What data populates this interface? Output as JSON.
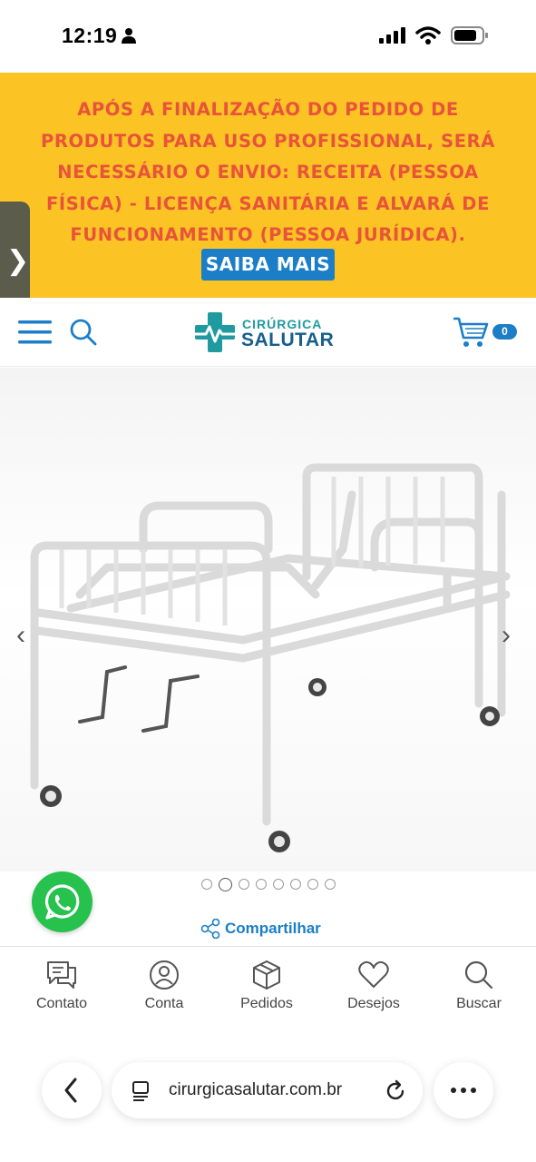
{
  "status_bar": {
    "time": "12:19"
  },
  "banner": {
    "lines": [
      "APÓS A FINALIZAÇÃO DO PEDIDO DE",
      "PRODUTOS PARA USO PROFISSIONAL, SERÁ",
      "NECESSÁRIO O ENVIO: RECEITA (PESSOA",
      "FÍSICA) - LICENÇA SANITÁRIA E ALVARÁ DE",
      "FUNCIONAMENTO (PESSOA JURÍDICA)."
    ],
    "button_label": "SAIBA MAIS",
    "background_color": "#fbc324",
    "text_color": "#e8533a"
  },
  "header": {
    "logo_top": "CIRÚRGICA",
    "logo_bottom": "SALUTAR",
    "cart_count": "0",
    "accent_color": "#1b7ec7"
  },
  "gallery": {
    "slide_count": 8,
    "active_slide": 2,
    "product_image": "hospital-bed-with-two-cranks"
  },
  "share": {
    "label": "Compartilhar"
  },
  "bottom_nav": {
    "items": [
      {
        "label": "Contato",
        "icon": "chat-icon"
      },
      {
        "label": "Conta",
        "icon": "user-icon"
      },
      {
        "label": "Pedidos",
        "icon": "box-icon"
      },
      {
        "label": "Desejos",
        "icon": "heart-icon"
      },
      {
        "label": "Buscar",
        "icon": "search-icon"
      }
    ]
  },
  "browser": {
    "url": "cirurgicasalutar.com.br"
  }
}
